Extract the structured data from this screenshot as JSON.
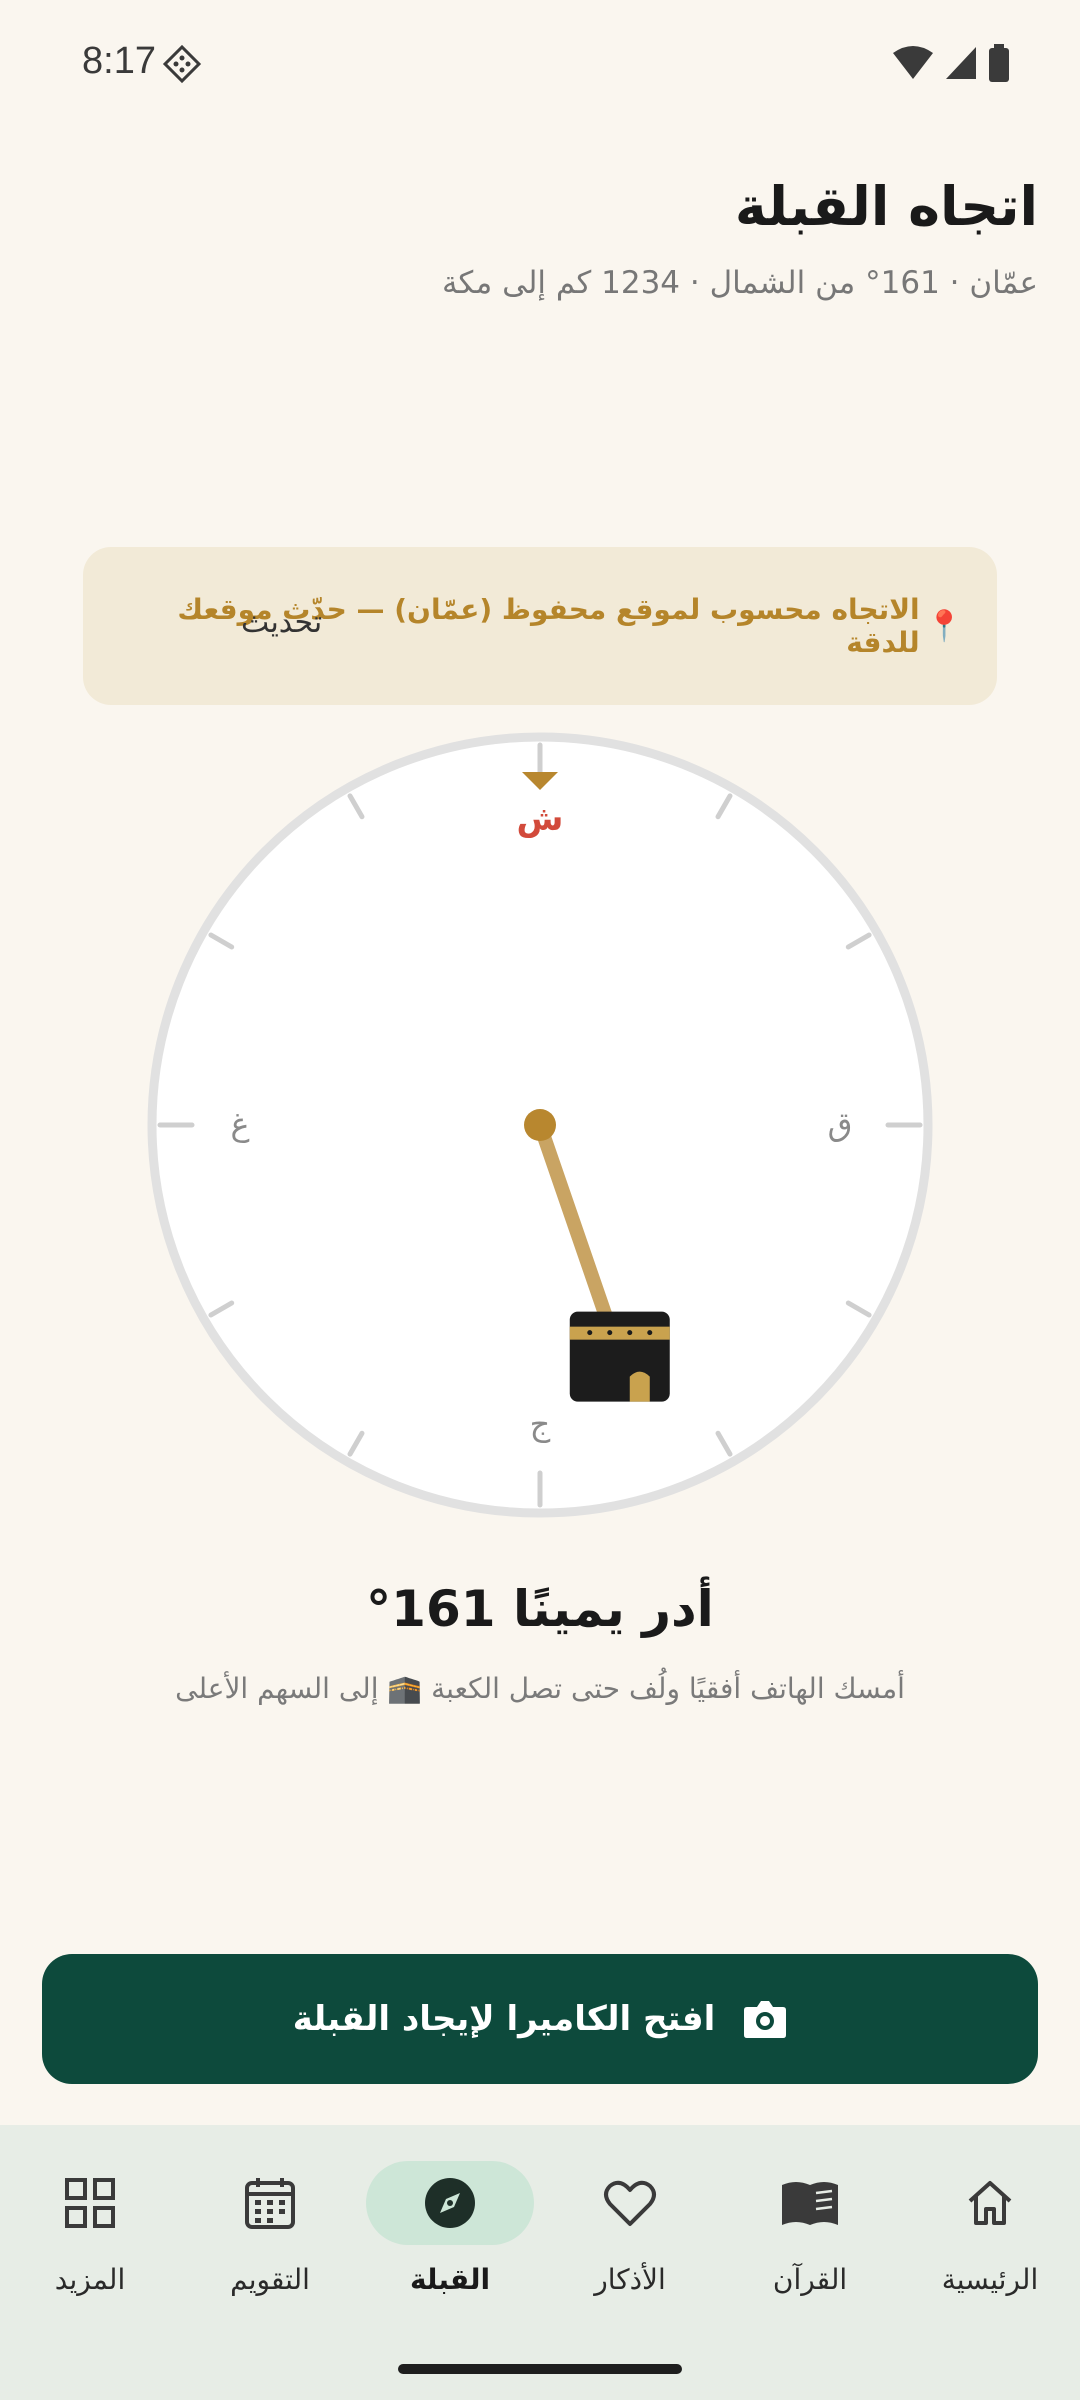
{
  "status_bar": {
    "time": "8:17"
  },
  "header": {
    "title": "اتجاه القبلة",
    "subtitle": "عمّان · 161° من الشمال · 1234 كم إلى مكة"
  },
  "banner": {
    "icon": "pin-icon",
    "text": "الاتجاه محسوب لموقع محفوظ (عمّان) — حدّث موقعك للدقة",
    "action_label": "تحديث"
  },
  "compass": {
    "north": "ش",
    "east": "ق",
    "south": "ج",
    "west": "غ",
    "qibla_bearing_deg": 161,
    "accent_color": "#B8872F",
    "north_color": "#D24A3B"
  },
  "instruction": {
    "title": "أدر يمينًا 161°",
    "hint": "أمسك الهاتف أفقيًا ولُف حتى تصل الكعبة 🕋 إلى السهم الأعلى"
  },
  "camera_button": {
    "label": "افتح الكاميرا لإيجاد القبلة",
    "icon": "camera-icon"
  },
  "nav": {
    "items": [
      {
        "label": "الرئيسية",
        "icon": "home-icon",
        "active": false
      },
      {
        "label": "القرآن",
        "icon": "book-icon",
        "active": false
      },
      {
        "label": "الأذكار",
        "icon": "heart-icon",
        "active": false
      },
      {
        "label": "القبلة",
        "icon": "compass-icon",
        "active": true
      },
      {
        "label": "التقويم",
        "icon": "calendar-icon",
        "active": false
      },
      {
        "label": "المزيد",
        "icon": "grid-icon",
        "active": false
      }
    ]
  }
}
